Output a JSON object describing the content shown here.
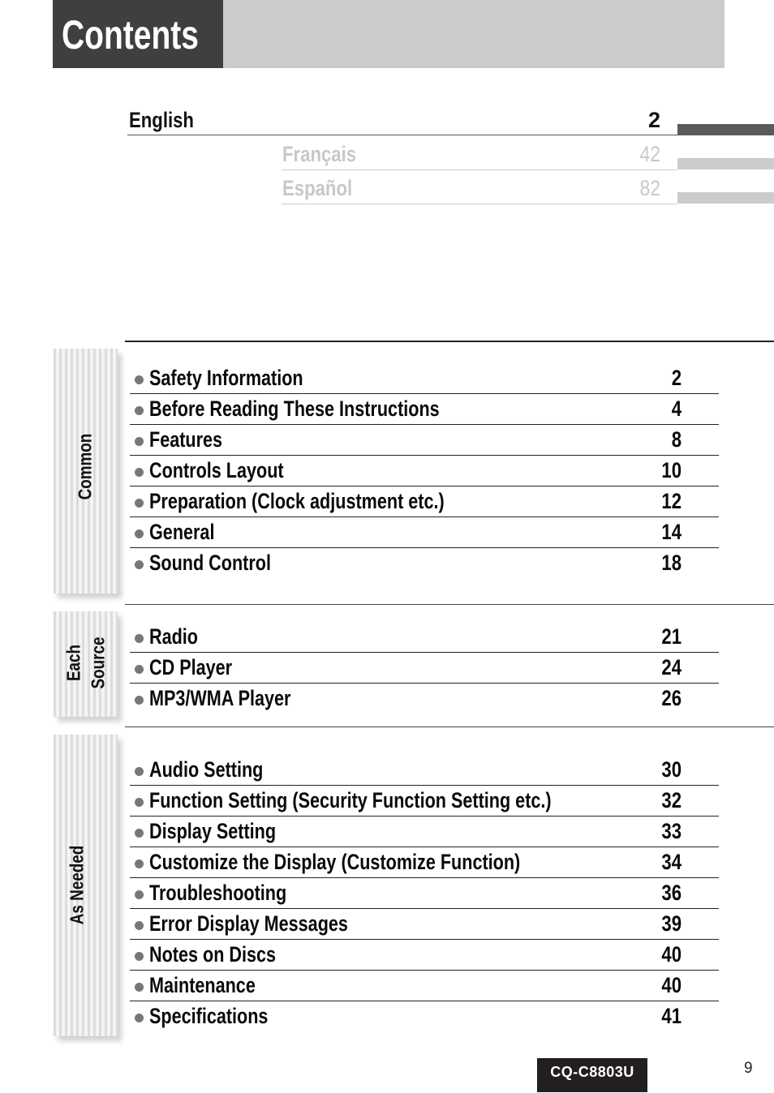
{
  "header": {
    "title": "Contents"
  },
  "languages": [
    {
      "name": "English",
      "page": "2",
      "active": true
    },
    {
      "name": "Français",
      "page": "42",
      "active": false
    },
    {
      "name": "Español",
      "page": "82",
      "active": false
    }
  ],
  "sections": [
    {
      "tab_label_lines": [
        "Common"
      ],
      "items": [
        {
          "title": "Safety Information",
          "page": "2"
        },
        {
          "title": "Before Reading These Instructions",
          "page": "4"
        },
        {
          "title": "Features",
          "page": "8"
        },
        {
          "title": "Controls Layout",
          "page": "10"
        },
        {
          "title": "Preparation (Clock adjustment etc.)",
          "page": "12"
        },
        {
          "title": "General",
          "page": "14"
        },
        {
          "title": "Sound Control",
          "page": "18"
        }
      ]
    },
    {
      "tab_label_lines": [
        "Each",
        "Source"
      ],
      "items": [
        {
          "title": "Radio",
          "page": "21"
        },
        {
          "title": "CD Player",
          "page": "24"
        },
        {
          "title": "MP3/WMA Player",
          "page": "26"
        }
      ]
    },
    {
      "tab_label_lines": [
        "As Needed"
      ],
      "items": [
        {
          "title": "Audio Setting",
          "page": "30"
        },
        {
          "title": "Function Setting (Security Function Setting etc.)",
          "page": "32"
        },
        {
          "title": "Display Setting",
          "page": "33"
        },
        {
          "title": "Customize the Display (Customize Function)",
          "page": "34"
        },
        {
          "title": "Troubleshooting",
          "page": "36"
        },
        {
          "title": "Error Display Messages",
          "page": "39"
        },
        {
          "title": "Notes on Discs",
          "page": "40"
        },
        {
          "title": "Maintenance",
          "page": "40"
        },
        {
          "title": "Specifications",
          "page": "41"
        }
      ]
    }
  ],
  "footer": {
    "model": "CQ-C8803U",
    "page_number": "9"
  },
  "colors": {
    "active_lang": "#111111",
    "inactive_lang": "#c8c8c8",
    "active_tab": "#5a5a5a",
    "inactive_tab": "#cccccc",
    "header_dark": "#3f3f3f",
    "header_light": "#cbcbcb"
  }
}
